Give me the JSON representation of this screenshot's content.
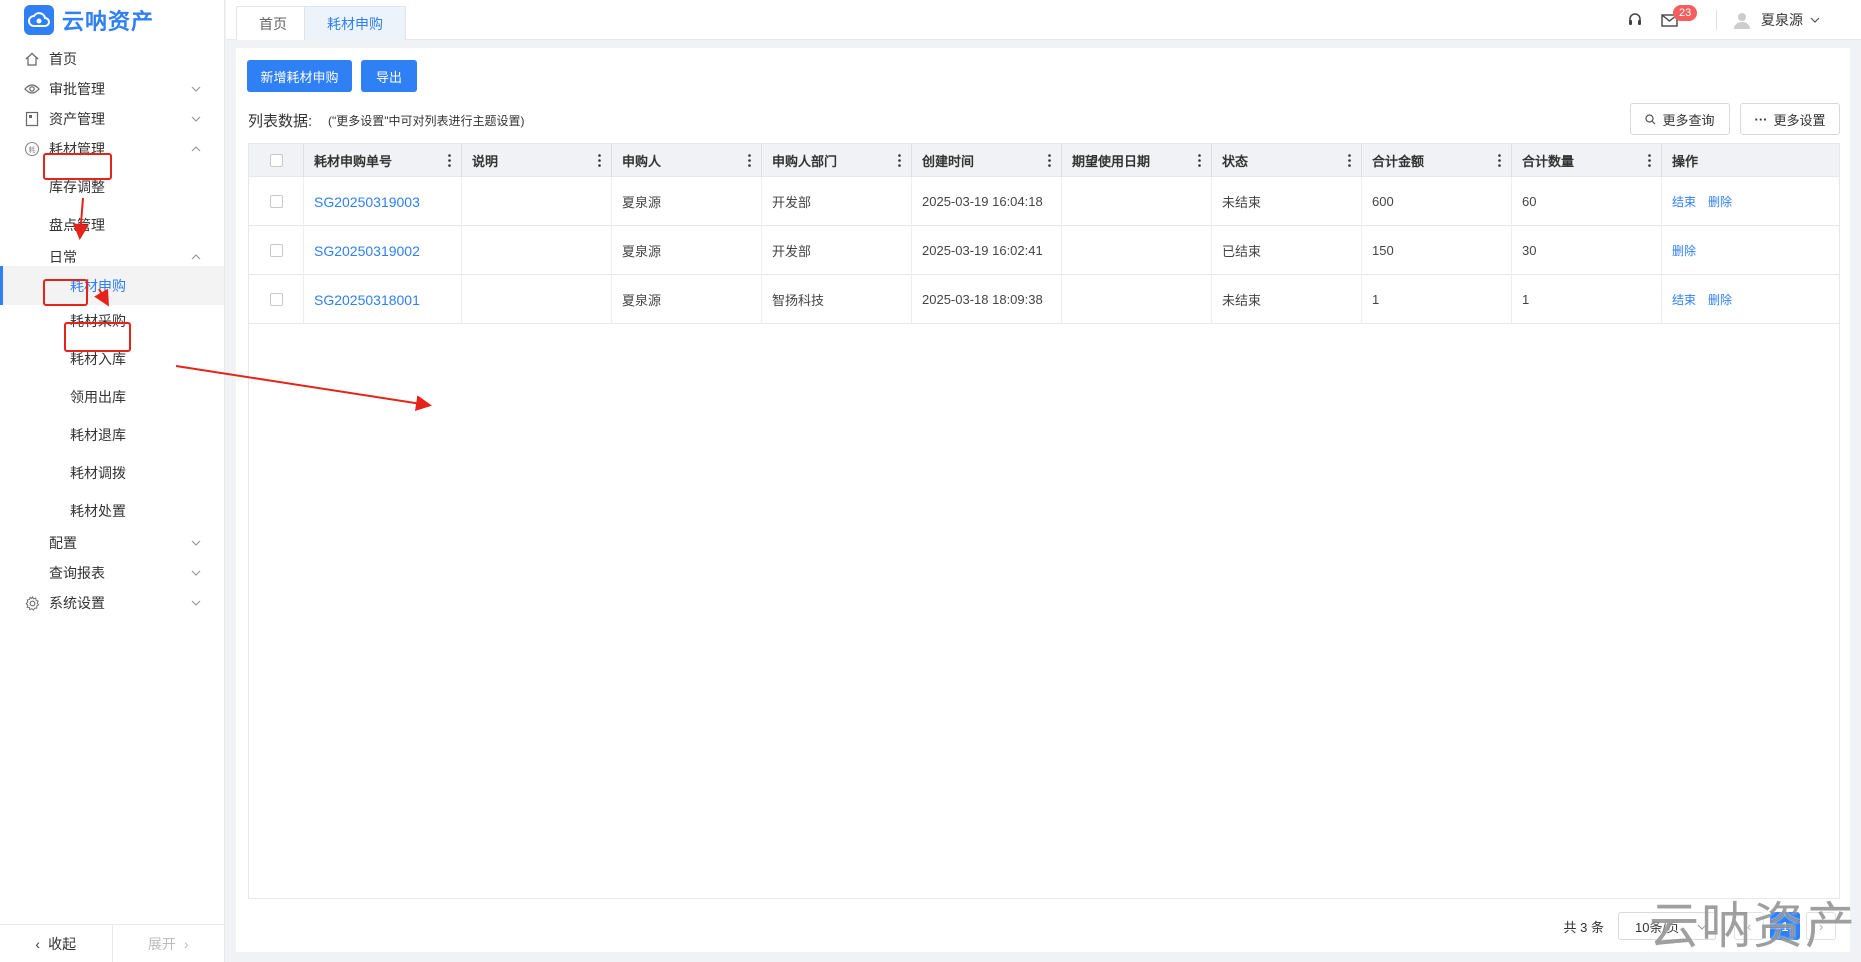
{
  "app": {
    "title": "云呐资产"
  },
  "sidebar": {
    "items": [
      {
        "label": "首页",
        "icon": "home-icon"
      },
      {
        "label": "审批管理",
        "icon": "eye-icon"
      },
      {
        "label": "资产管理",
        "icon": "asset-icon"
      },
      {
        "label": "耗材管理",
        "icon": "consumable-icon"
      },
      {
        "label": "库存调整"
      },
      {
        "label": "盘点管理"
      },
      {
        "label": "日常"
      },
      {
        "label": "耗材申购"
      },
      {
        "label": "耗材采购"
      },
      {
        "label": "耗材入库"
      },
      {
        "label": "领用出库"
      },
      {
        "label": "耗材退库"
      },
      {
        "label": "耗材调拨"
      },
      {
        "label": "耗材处置"
      },
      {
        "label": "配置"
      },
      {
        "label": "查询报表"
      },
      {
        "label": "系统设置",
        "icon": "gear-icon"
      }
    ],
    "collapse": "收起",
    "expand": "展开"
  },
  "tabs": [
    {
      "label": "首页"
    },
    {
      "label": "耗材申购"
    }
  ],
  "header": {
    "badge": "23",
    "user": "夏泉源"
  },
  "toolbar": {
    "add": "新增耗材申购",
    "export": "导出",
    "more_query": "更多查询",
    "more_settings": "更多设置"
  },
  "list": {
    "title": "列表数据:",
    "hint": "(\"更多设置\"中可对列表进行主题设置)"
  },
  "table": {
    "columns": [
      "耗材申购单号",
      "说明",
      "申购人",
      "申购人部门",
      "创建时间",
      "期望使用日期",
      "状态",
      "合计金额",
      "合计数量",
      "操作"
    ],
    "rows": [
      {
        "no": "SG20250319003",
        "desc": "",
        "applicant": "夏泉源",
        "dept": "开发部",
        "created": "2025-03-19 16:04:18",
        "expected": "",
        "status": "未结束",
        "amount": "600",
        "qty": "60",
        "ops": [
          "结束",
          "删除"
        ]
      },
      {
        "no": "SG20250319002",
        "desc": "",
        "applicant": "夏泉源",
        "dept": "开发部",
        "created": "2025-03-19 16:02:41",
        "expected": "",
        "status": "已结束",
        "amount": "150",
        "qty": "30",
        "ops": [
          "删除"
        ]
      },
      {
        "no": "SG20250318001",
        "desc": "",
        "applicant": "夏泉源",
        "dept": "智扬科技",
        "created": "2025-03-18 18:09:38",
        "expected": "",
        "status": "未结束",
        "amount": "1",
        "qty": "1",
        "ops": [
          "结束",
          "删除"
        ]
      }
    ]
  },
  "pager": {
    "total": "共 3 条",
    "page_size": "10条/页",
    "current": "1"
  },
  "watermark": "云呐资产",
  "colors": {
    "primary": "#2f7ff5",
    "annotation": "#e5231a"
  }
}
